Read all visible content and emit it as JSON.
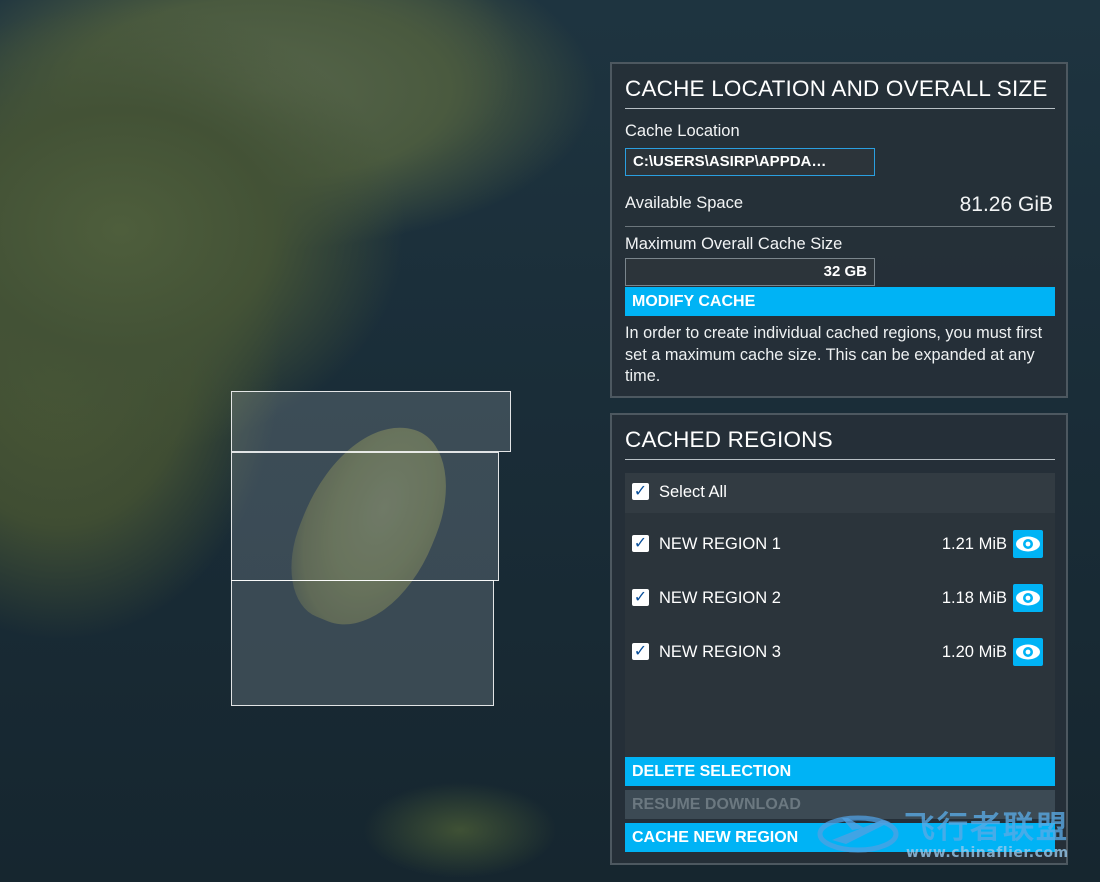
{
  "cache_panel": {
    "title": "CACHE LOCATION AND OVERALL SIZE",
    "cache_location_label": "Cache Location",
    "cache_location_value": "C:\\USERS\\ASIRP\\APPDA…",
    "available_space_label": "Available Space",
    "available_space_value": "81.26 GiB",
    "max_cache_label": "Maximum Overall Cache Size",
    "max_cache_value": "32 GB",
    "modify_button": "MODIFY CACHE",
    "info_text": "In order to create individual cached regions, you must first set a maximum cache size. This can be expanded at any time."
  },
  "regions_panel": {
    "title": "CACHED REGIONS",
    "select_all_label": "Select All",
    "select_all_checked": true,
    "regions": [
      {
        "name": "NEW REGION 1",
        "size": "1.21 MiB",
        "checked": true
      },
      {
        "name": "NEW REGION 2",
        "size": "1.18 MiB",
        "checked": true
      },
      {
        "name": "NEW REGION 3",
        "size": "1.20 MiB",
        "checked": true
      }
    ],
    "delete_button": "DELETE SELECTION",
    "resume_button": "RESUME DOWNLOAD",
    "cache_new_button": "CACHE NEW REGION"
  },
  "watermark": {
    "text": "飞行者联盟",
    "url": "www.chinaflier.com"
  },
  "colors": {
    "accent": "#00b3f5",
    "panel_bg": "#263038",
    "disabled": "#3c4a54"
  },
  "icons": {
    "checkbox": "check-icon",
    "eye": "eye-icon"
  }
}
